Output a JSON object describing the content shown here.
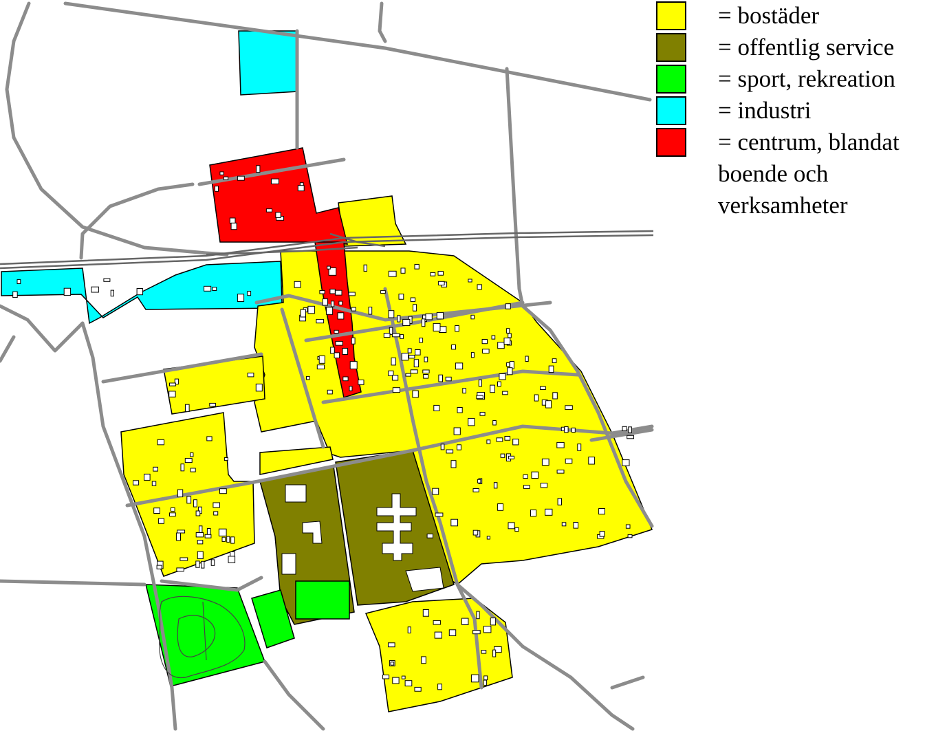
{
  "legend": {
    "items": [
      {
        "label": "= bostäder",
        "color": "#ffff00"
      },
      {
        "label": "= offentlig service",
        "color": "#808000"
      },
      {
        "label": "= sport, rekreation",
        "color": "#00ff00"
      },
      {
        "label": "= industri",
        "color": "#00ffff"
      },
      {
        "label": "= centrum, blandat",
        "color": "#ff0000"
      }
    ],
    "continuation": [
      "boende och",
      "verksamheter"
    ]
  },
  "zone_colors": {
    "residential": "#ffff00",
    "public_service": "#808000",
    "sport_recreation": "#00ff00",
    "industry": "#00ffff",
    "centre_mixed": "#ff0000",
    "road": "#8c8c8c",
    "railway": "#666666",
    "building_outline": "#000000",
    "background": "#ffffff"
  }
}
